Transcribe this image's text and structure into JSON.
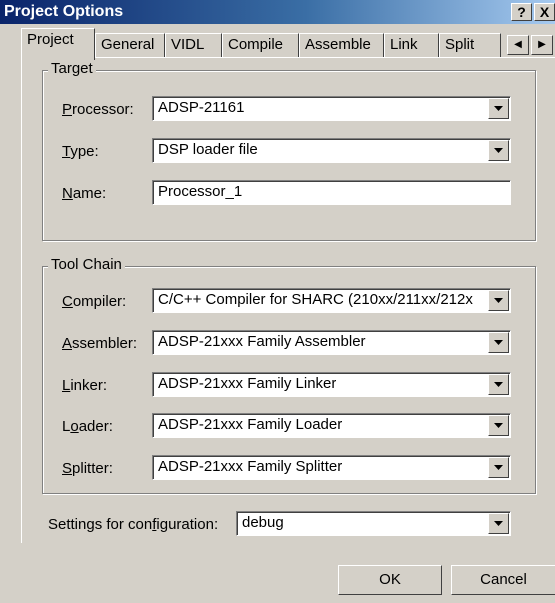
{
  "window": {
    "title": "Project Options",
    "help_glyph": "?",
    "close_glyph": "X"
  },
  "tabs": [
    {
      "label": "Project",
      "active": true
    },
    {
      "label": "General"
    },
    {
      "label": "VIDL"
    },
    {
      "label": "Compile"
    },
    {
      "label": "Assemble"
    },
    {
      "label": "Link"
    },
    {
      "label": "Split"
    }
  ],
  "tab_scroll": {
    "left_icon": "arrow-left-icon",
    "right_icon": "arrow-right-icon"
  },
  "target": {
    "group_label": "Target",
    "processor": {
      "label_u": "P",
      "label_rest": "rocessor:",
      "value": "ADSP-21161"
    },
    "type": {
      "label_u": "T",
      "label_rest": "ype:",
      "value": "DSP loader file"
    },
    "name": {
      "label_u": "N",
      "label_rest": "ame:",
      "value": "Processor_1"
    }
  },
  "tool_chain": {
    "group_label": "Tool Chain",
    "compiler": {
      "label_u": "C",
      "label_rest": "ompiler:",
      "value": "C/C++ Compiler for SHARC (210xx/211xx/212x"
    },
    "assembler": {
      "label_u": "A",
      "label_rest": "ssembler:",
      "value": "ADSP-21xxx Family Assembler"
    },
    "linker": {
      "label_u": "L",
      "label_rest": "inker:",
      "value": "ADSP-21xxx Family Linker"
    },
    "loader": {
      "label_pre": "L",
      "label_u": "o",
      "label_rest": "ader:",
      "value": "ADSP-21xxx Family Loader"
    },
    "splitter": {
      "label_u": "S",
      "label_rest": "plitter:",
      "value": "ADSP-21xxx Family Splitter"
    }
  },
  "configuration": {
    "label_pre": "Settings for con",
    "label_u": "f",
    "label_rest": "iguration:",
    "value": "debug"
  },
  "buttons": {
    "ok": "OK",
    "cancel": "Cancel"
  }
}
